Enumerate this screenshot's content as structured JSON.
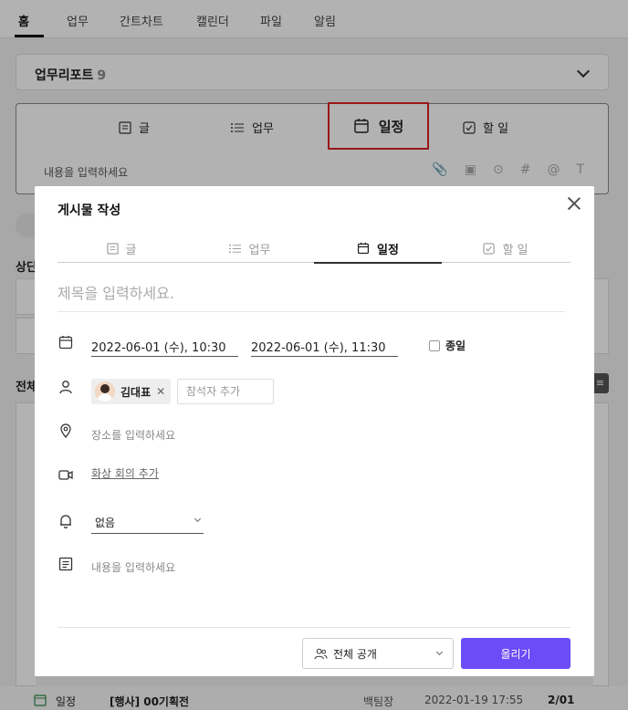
{
  "nav": {
    "tabs": [
      "홈",
      "업무",
      "간트차트",
      "캘린더",
      "파일",
      "알림"
    ]
  },
  "report": {
    "title": "업무리포트",
    "count": "9"
  },
  "composer": {
    "tabs": [
      "글",
      "업무",
      "일정",
      "할 일"
    ],
    "highlighted_tab": "일정",
    "placeholder": "내용을 입력하세요",
    "tools": [
      "📎",
      "▣",
      "⊙",
      "#",
      "@",
      "T"
    ]
  },
  "background": {
    "side_label_1": "상단",
    "side_label_2": "전체",
    "bottom_row": {
      "type": "일정",
      "title": "[행사] 00기획전",
      "author": "백팀장",
      "datetime": "2022-01-19 17:55",
      "page": "2/01"
    }
  },
  "modal": {
    "title": "게시물 작성",
    "tabs": [
      {
        "label": "글",
        "active": false
      },
      {
        "label": "업무",
        "active": false
      },
      {
        "label": "일정",
        "active": true
      },
      {
        "label": "할 일",
        "active": false
      }
    ],
    "title_placeholder": "제목을 입력하세요.",
    "start_datetime": "2022-06-01 (수), 10:30",
    "end_datetime": "2022-06-01 (수), 11:30",
    "allday_label": "종일",
    "attendee_chip": "김대표",
    "attendee_placeholder": "참석자 추가",
    "location_placeholder": "장소를 입력하세요",
    "video_meeting": "화상 회의 추가",
    "alarm_value": "없음",
    "content_placeholder": "내용을 입력하세요",
    "visibility": "전체 공개",
    "submit_label": "올리기",
    "accent_color": "#6b4cf6"
  }
}
